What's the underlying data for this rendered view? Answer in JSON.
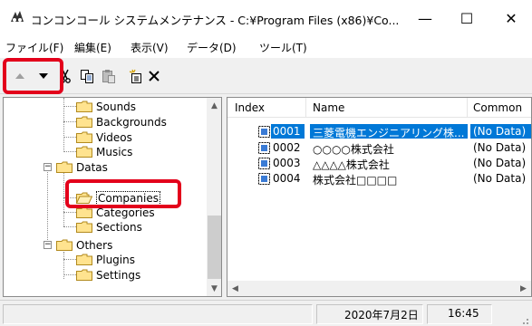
{
  "window": {
    "title": "コンコンコール システムメンテナンス - C:¥Program Files (x86)¥Co...",
    "minimize_glyph": "—",
    "maximize_glyph": "☐",
    "close_glyph": "✕"
  },
  "menu": {
    "items": [
      {
        "label": "ファイル(F)"
      },
      {
        "label": "編集(E)"
      },
      {
        "label": "表示(V)"
      },
      {
        "label": "データ(D)"
      },
      {
        "label": "ツール(T)"
      }
    ]
  },
  "toolbar": {
    "icons": [
      "arrow-up-icon",
      "arrow-down-icon",
      "cut-icon",
      "copy-icon",
      "paste-icon",
      "new-item-icon",
      "delete-icon"
    ],
    "highlight_color": "#e3001b"
  },
  "tree": {
    "items": [
      {
        "label": "Sounds"
      },
      {
        "label": "Backgrounds"
      },
      {
        "label": "Videos"
      },
      {
        "label": "Musics"
      },
      {
        "label": "Datas"
      },
      {
        "label": "Companies"
      },
      {
        "label": "Categories"
      },
      {
        "label": "Sections"
      },
      {
        "label": "Others"
      },
      {
        "label": "Plugins"
      },
      {
        "label": "Settings"
      }
    ],
    "expanded_glyph": "−"
  },
  "list": {
    "columns": [
      "Index",
      "Name",
      "Common"
    ],
    "rows": [
      {
        "index": "0001",
        "name": "三菱電機エンジニアリング株...",
        "common": "(No Data)",
        "selected": true
      },
      {
        "index": "0002",
        "name": "○○○○株式会社",
        "common": "(No Data)",
        "selected": false
      },
      {
        "index": "0003",
        "name": "△△△△株式会社",
        "common": "(No Data)",
        "selected": false
      },
      {
        "index": "0004",
        "name": "株式会社□□□□",
        "common": "(No Data)",
        "selected": false
      }
    ],
    "selection_color": "#0078d7"
  },
  "status": {
    "date": "2020年7月2日",
    "time": "16:45"
  }
}
